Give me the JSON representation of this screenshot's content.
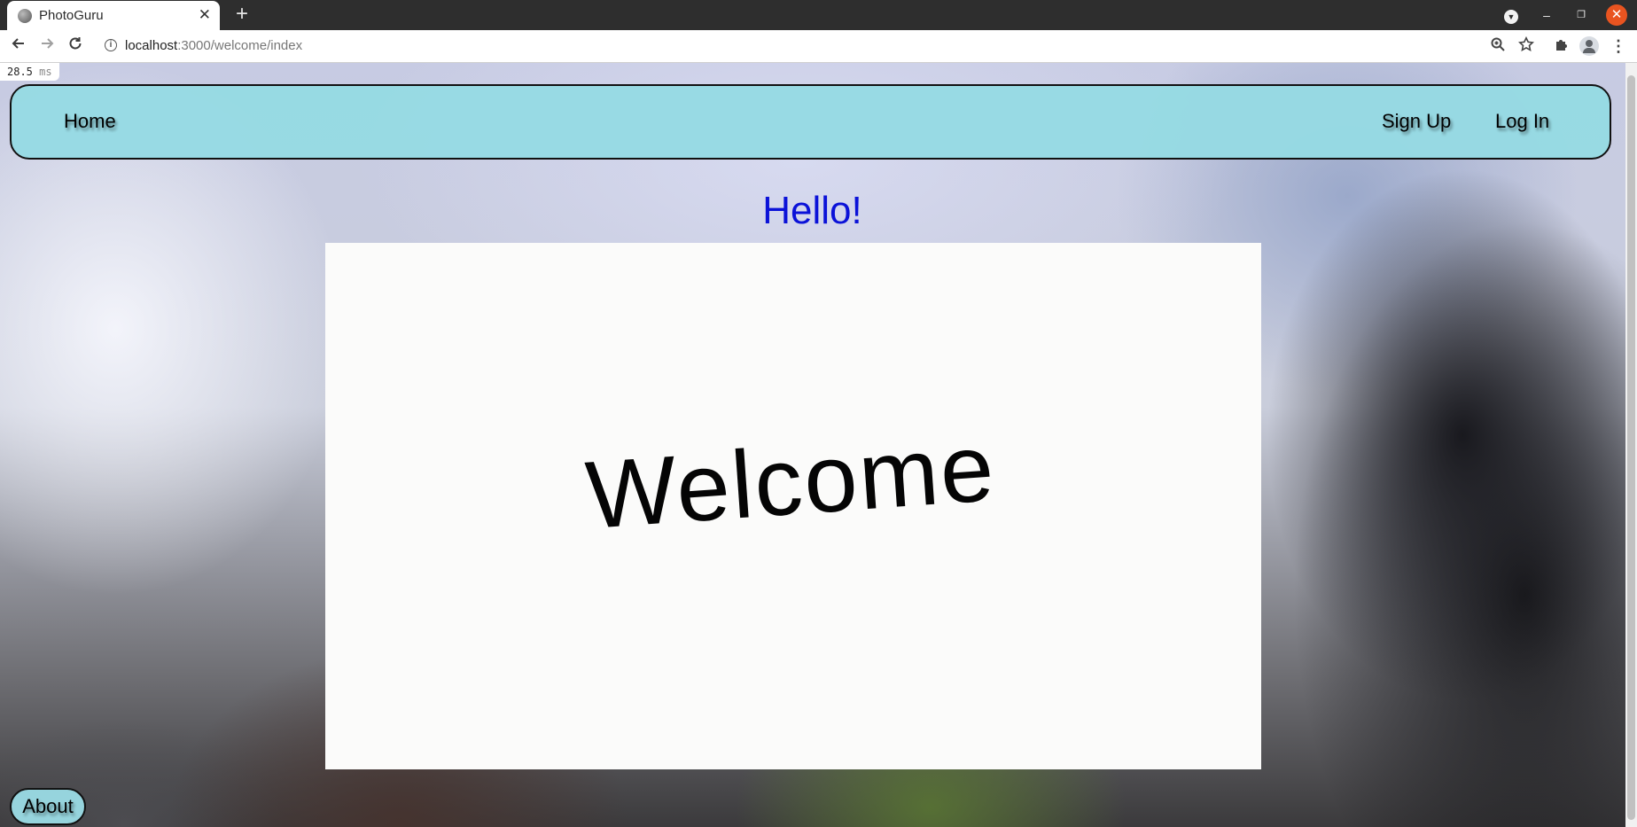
{
  "browser": {
    "tab": {
      "title": "PhotoGuru",
      "favicon_icon": "photoguru-favicon-icon",
      "close_glyph": "✕"
    },
    "new_tab_glyph": "+",
    "url": {
      "host": "localhost",
      "path": ":3000/welcome/index"
    },
    "window_controls": {
      "dropdown_glyph": "▼",
      "minimize_glyph": "–",
      "maximize_glyph": "❐",
      "close_glyph": "✕",
      "close_color": "#e95420"
    },
    "toolbar_icons": [
      "zoom-icon",
      "star-icon",
      "extensions-icon",
      "profile-icon",
      "menu-icon"
    ]
  },
  "overlay": {
    "timing_value": "28.5",
    "timing_unit": "ms"
  },
  "navbar": {
    "home_label": "Home",
    "signup_label": "Sign Up",
    "login_label": "Log In",
    "background_color": "#96dae3"
  },
  "main": {
    "heading": "Hello!",
    "heading_color": "#0b12d8",
    "card_text": "Welcome"
  },
  "footer": {
    "about_label": "About"
  }
}
